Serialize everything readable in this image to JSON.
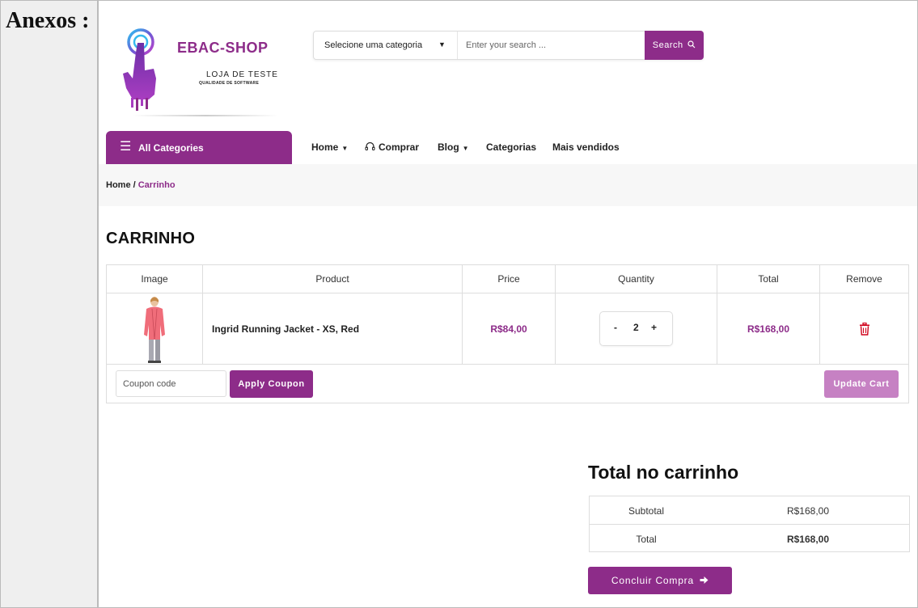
{
  "side_label": "Anexos :",
  "logo": {
    "brand": "EBAC-SHOP",
    "tagline": "LOJA DE TESTE",
    "subtagline": "QUALIDADE DE SOFTWARE"
  },
  "search": {
    "category_label": "Selecione uma categoria",
    "placeholder": "Enter your search ...",
    "button_label": "Search"
  },
  "all_categories": "All Categories",
  "nav": {
    "home": "Home",
    "comprar": "Comprar",
    "blog": "Blog",
    "categorias": "Categorias",
    "mais_vendidos": "Mais vendidos"
  },
  "breadcrumb": {
    "home": "Home",
    "sep": " / ",
    "current": "Carrinho"
  },
  "cart": {
    "title": "CARRINHO",
    "headers": {
      "image": "Image",
      "product": "Product",
      "price": "Price",
      "quantity": "Quantity",
      "total": "Total",
      "remove": "Remove"
    },
    "items": [
      {
        "name": "Ingrid Running Jacket - XS, Red",
        "price": "R$84,00",
        "qty": "2",
        "total": "R$168,00"
      }
    ],
    "qty_minus": "-",
    "qty_plus": "+",
    "coupon_placeholder": "Coupon code",
    "apply_label": "Apply Coupon",
    "update_label": "Update Cart"
  },
  "totals": {
    "title": "Total no carrinho",
    "subtotal_label": "Subtotal",
    "subtotal_value": "R$168,00",
    "total_label": "Total",
    "total_value": "R$168,00",
    "checkout_label": "Concluir Compra"
  },
  "colors": {
    "accent": "#8d2c89",
    "accent_light": "#c681c3",
    "remove_icon": "#d0021b"
  }
}
